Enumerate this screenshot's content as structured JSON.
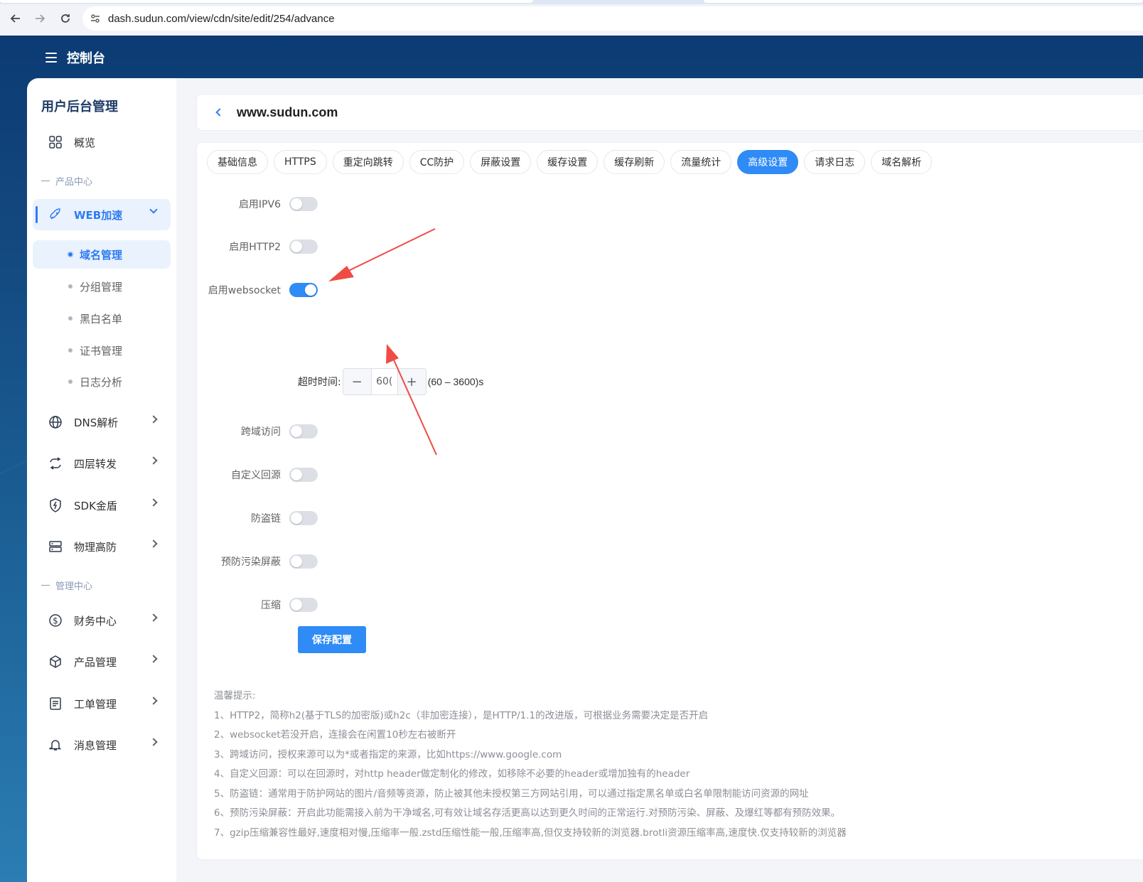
{
  "browser": {
    "url": "dash.sudun.com/view/cdn/site/edit/254/advance"
  },
  "header": {
    "title": "控制台"
  },
  "sidebar": {
    "title": "用户后台管理",
    "overview": "概览",
    "section_product": "产品中心",
    "web_accel": "WEB加速",
    "sub_items": [
      "域名管理",
      "分组管理",
      "黑白名单",
      "证书管理",
      "日志分析"
    ],
    "items": [
      "DNS解析",
      "四层转发",
      "SDK金盾",
      "物理高防"
    ],
    "section_admin": "管理中心",
    "admin_items": [
      "财务中心",
      "产品管理",
      "工单管理",
      "消息管理"
    ]
  },
  "main": {
    "domain": "www.sudun.com",
    "tabs": [
      "基础信息",
      "HTTPS",
      "重定向跳转",
      "CC防护",
      "屏蔽设置",
      "缓存设置",
      "缓存刷新",
      "流量统计",
      "高级设置",
      "请求日志",
      "域名解析"
    ],
    "active_tab": "高级设置",
    "settings": [
      {
        "label": "启用IPV6",
        "on": false
      },
      {
        "label": "启用HTTP2",
        "on": false
      },
      {
        "label": "启用websocket",
        "on": true
      },
      {
        "label": "跨域访问",
        "on": false
      },
      {
        "label": "自定义回源",
        "on": false
      },
      {
        "label": "防盗链",
        "on": false
      },
      {
        "label": "预防污染屏蔽",
        "on": false
      },
      {
        "label": "压缩",
        "on": false
      }
    ],
    "timeout": {
      "label": "超时时间:",
      "value": "60(",
      "minus": "−",
      "plus": "+",
      "range": "(60 – 3600)s"
    },
    "save_button": "保存配置",
    "tips_title": "温馨提示:",
    "tips": [
      "1、HTTP2，简称h2(基于TLS的加密版)或h2c（非加密连接），是HTTP/1.1的改进版，可根据业务需要决定是否开启",
      "2、websocket若没开启，连接会在闲置10秒左右被断开",
      "3、跨域访问，授权来源可以为*或者指定的来源，比如https://www.google.com",
      "4、自定义回源：可以在回源时，对http header做定制化的修改，如移除不必要的header或增加独有的header",
      "5、防盗链：通常用于防护网站的图片/音频等资源，防止被其他未授权第三方网站引用，可以通过指定黑名单或白名单限制能访问资源的网址",
      "6、预防污染屏蔽：开启此功能需接入前为干净域名,可有效让域名存活更高以达到更久时间的正常运行.对预防污染、屏蔽、及爆红等都有预防效果。",
      "7、gzip压缩兼容性最好,速度相对慢,压缩率一般.zstd压缩性能一般,压缩率高,但仅支持较新的浏览器.brotli资源压缩率高,速度快.仅支持较新的浏览器"
    ]
  },
  "colors": {
    "accent": "#2f8bf6",
    "annotation_arrow": "#f04c45"
  }
}
